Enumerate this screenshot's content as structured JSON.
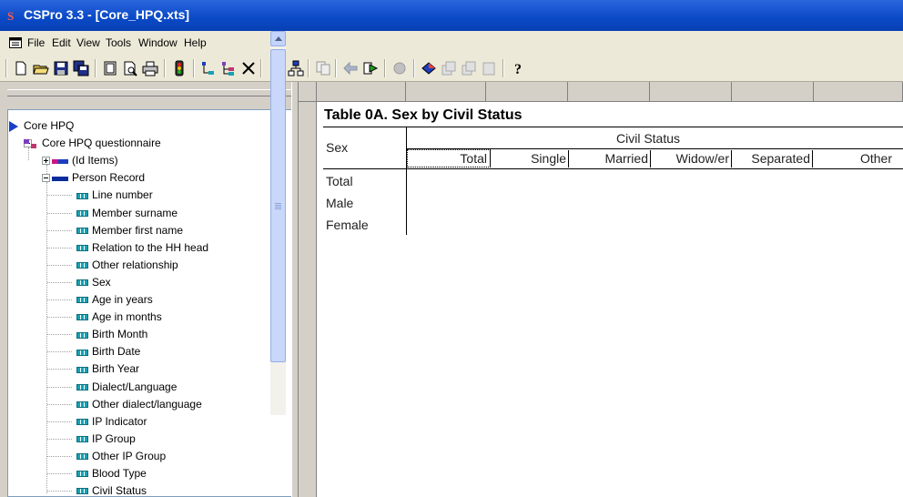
{
  "window": {
    "title": "CSPro 3.3 - [Core_HPQ.xts]",
    "app_icon": "cspro-logo-icon",
    "title_color": "#0a49c6"
  },
  "menu": {
    "items": [
      "File",
      "Edit",
      "View",
      "Tools",
      "Window",
      "Help"
    ]
  },
  "toolbar": {
    "icons": [
      "new-icon",
      "open-icon",
      "save-icon",
      "save-all-icon",
      "page-icon",
      "print-preview-icon",
      "print-icon",
      "run-icon",
      "tree-icon",
      "tree-expand-icon",
      "close-x-icon",
      "grid-icon",
      "hierarchy-icon",
      "copy-icon",
      "back-icon",
      "forward-icon",
      "stop-icon",
      "flag-icon",
      "layers-icon",
      "stack-icon",
      "pages-icon",
      "help-icon"
    ]
  },
  "tree": {
    "dictionary": "Core HPQ",
    "questionnaire": "Core HPQ questionnaire",
    "id_items": "(Id Items)",
    "record": "Person Record",
    "items": [
      "Line number",
      "Member surname",
      "Member first name",
      "Relation to the HH head",
      "Other relationship",
      "Sex",
      "Age in years",
      "Age in months",
      "Birth Month",
      "Birth Date",
      "Birth Year",
      "Dialect/Language",
      "Other dialect/language",
      "IP Indicator",
      "IP Group",
      "Other IP Group",
      "Blood Type",
      "Civil Status"
    ]
  },
  "table": {
    "title": "Table 0A. Sex by Civil Status",
    "stub_header": "Sex",
    "spanner": "Civil Status",
    "columns": [
      "Total",
      "Single",
      "Married",
      "Widow/er",
      "Separated",
      "Other"
    ],
    "rows": [
      "Total",
      "Male",
      "Female"
    ]
  }
}
